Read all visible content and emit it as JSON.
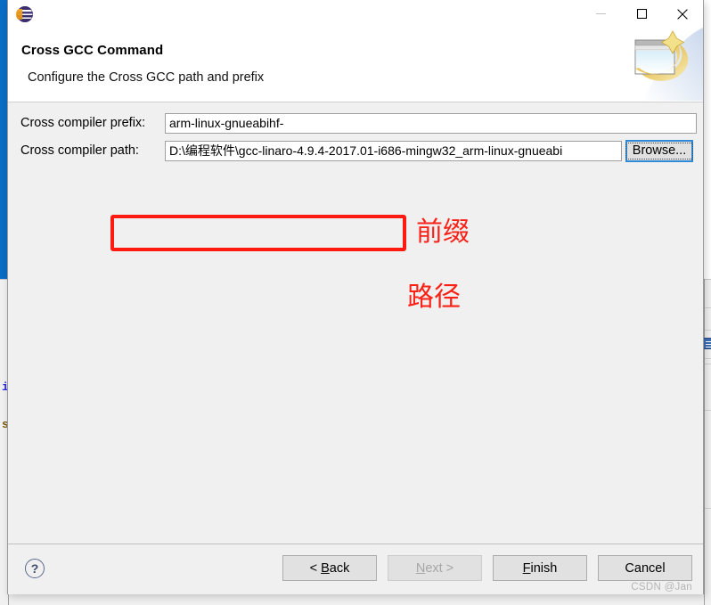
{
  "window": {
    "app_icon": "eclipse-logo-icon",
    "minimize_label": "Minimize",
    "maximize_label": "Maximize",
    "close_label": "Close"
  },
  "header": {
    "title": "Cross GCC Command",
    "subtitle": "Configure the Cross GCC path and prefix",
    "banner_icon": "wizard-banner-icon"
  },
  "form": {
    "prefix": {
      "label": "Cross compiler prefix:",
      "value": "arm-linux-gnueabihf-",
      "placeholder": ""
    },
    "path": {
      "label": "Cross compiler path:",
      "value": "D:\\编程软件\\gcc-linaro-4.9.4-2017.01-i686-mingw32_arm-linux-gnueabi",
      "placeholder": "",
      "browse_label": "Browse..."
    }
  },
  "annotations": {
    "prefix_note": "前缀",
    "path_note": "路径",
    "color": "#fb2116"
  },
  "footer": {
    "help_label": "?",
    "buttons": [
      {
        "id": "back",
        "label": "< Back",
        "mnemonic": "B",
        "disabled": false
      },
      {
        "id": "next",
        "label": "Next >",
        "mnemonic": "N",
        "disabled": true
      },
      {
        "id": "finish",
        "label": "Finish",
        "mnemonic": "F",
        "disabled": false
      },
      {
        "id": "cancel",
        "label": "Cancel",
        "mnemonic": "",
        "disabled": false
      }
    ],
    "watermark": "CSDN @Jan"
  },
  "background": {
    "code_i": "i",
    "code_s": "s"
  }
}
